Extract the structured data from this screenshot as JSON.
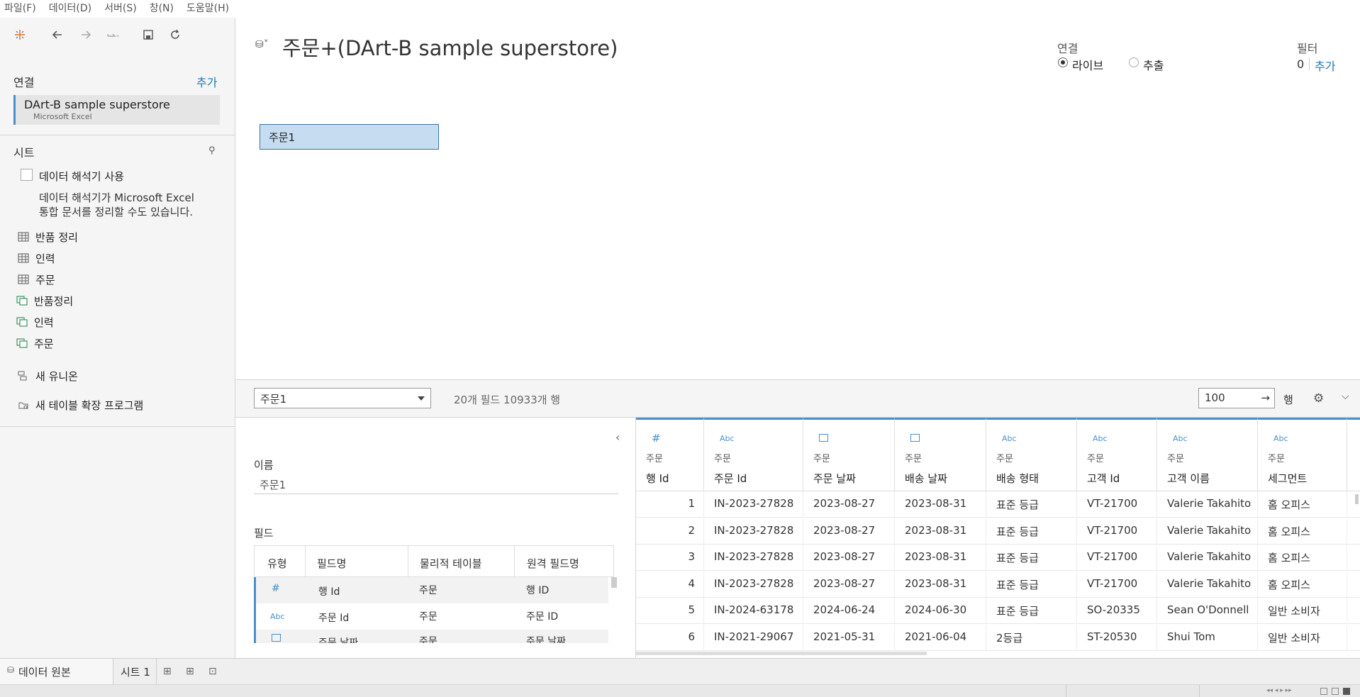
{
  "menu": [
    "파일(F)",
    "데이터(D)",
    "서버(S)",
    "창(N)",
    "도움말(H)"
  ],
  "left": {
    "connections_label": "연결",
    "add_label": "추가",
    "connection": {
      "name": "DArt-B sample superstore",
      "type": "Microsoft Excel"
    },
    "sheets_label": "시트",
    "interpreter_label": "데이터 해석기 사용",
    "interpreter_desc_1": "데이터 해석기가 Microsoft Excel",
    "interpreter_desc_2": "통합 문서를 정리할 수도 있습니다.",
    "sheets": [
      "반품 정리",
      "인력",
      "주문"
    ],
    "named_ranges": [
      "반품정리",
      "인력",
      "주문"
    ],
    "new_union": "새 유니온",
    "new_extension": "새 테이블 확장 프로그램"
  },
  "canvas": {
    "title": "주문+(DArt-B sample superstore)",
    "connection_label": "연결",
    "live_label": "라이브",
    "extract_label": "추출",
    "filter_label": "필터",
    "filter_count": "0",
    "filter_add": "추가",
    "table_name": "주문1"
  },
  "toolbar2": {
    "selected_table": "주문1",
    "summary": "20개 필드 10933개 행",
    "rows_value": "100",
    "rows_label": "행"
  },
  "meta": {
    "name_label": "이름",
    "name_value": "주문1",
    "fields_label": "필드",
    "headers": [
      "유형",
      "필드명",
      "물리적 테이블",
      "원격 필드명"
    ],
    "rows": [
      {
        "type": "#",
        "name": "행 Id",
        "table": "주문",
        "remote": "행 ID"
      },
      {
        "type": "Abc",
        "name": "주문 Id",
        "table": "주문",
        "remote": "주문 ID"
      },
      {
        "type": "date",
        "name": "주문 날짜",
        "table": "주문",
        "remote": "주문 날짜"
      }
    ]
  },
  "grid": {
    "columns": [
      {
        "icon": "#",
        "source": "주문",
        "name": "행 Id"
      },
      {
        "icon": "Abc",
        "source": "주문",
        "name": "주문 Id"
      },
      {
        "icon": "date",
        "source": "주문",
        "name": "주문 날짜"
      },
      {
        "icon": "date",
        "source": "주문",
        "name": "배송 날짜"
      },
      {
        "icon": "Abc",
        "source": "주문",
        "name": "배송 형태"
      },
      {
        "icon": "Abc",
        "source": "주문",
        "name": "고객 Id"
      },
      {
        "icon": "Abc",
        "source": "주문",
        "name": "고객 이름"
      },
      {
        "icon": "Abc",
        "source": "주문",
        "name": "세그먼트"
      }
    ],
    "rows": [
      [
        "1",
        "IN-2023-27828",
        "2023-08-27",
        "2023-08-31",
        "표준 등급",
        "VT-21700",
        "Valerie Takahito",
        "홈 오피스"
      ],
      [
        "2",
        "IN-2023-27828",
        "2023-08-27",
        "2023-08-31",
        "표준 등급",
        "VT-21700",
        "Valerie Takahito",
        "홈 오피스"
      ],
      [
        "3",
        "IN-2023-27828",
        "2023-08-27",
        "2023-08-31",
        "표준 등급",
        "VT-21700",
        "Valerie Takahito",
        "홈 오피스"
      ],
      [
        "4",
        "IN-2023-27828",
        "2023-08-27",
        "2023-08-31",
        "표준 등급",
        "VT-21700",
        "Valerie Takahito",
        "홈 오피스"
      ],
      [
        "5",
        "IN-2024-63178",
        "2024-06-24",
        "2024-06-30",
        "표준 등급",
        "SO-20335",
        "Sean O'Donnell",
        "일반 소비자"
      ],
      [
        "6",
        "IN-2021-29067",
        "2021-05-31",
        "2021-06-04",
        "2등급",
        "ST-20530",
        "Shui Tom",
        "일반 소비자"
      ]
    ]
  },
  "tabs": {
    "datasource": "데이터 원본",
    "sheet1": "시트 1"
  },
  "colors": {
    "accent": "#4a90c9",
    "link": "#1f77b4",
    "selected_table": "#c6dcf0"
  }
}
